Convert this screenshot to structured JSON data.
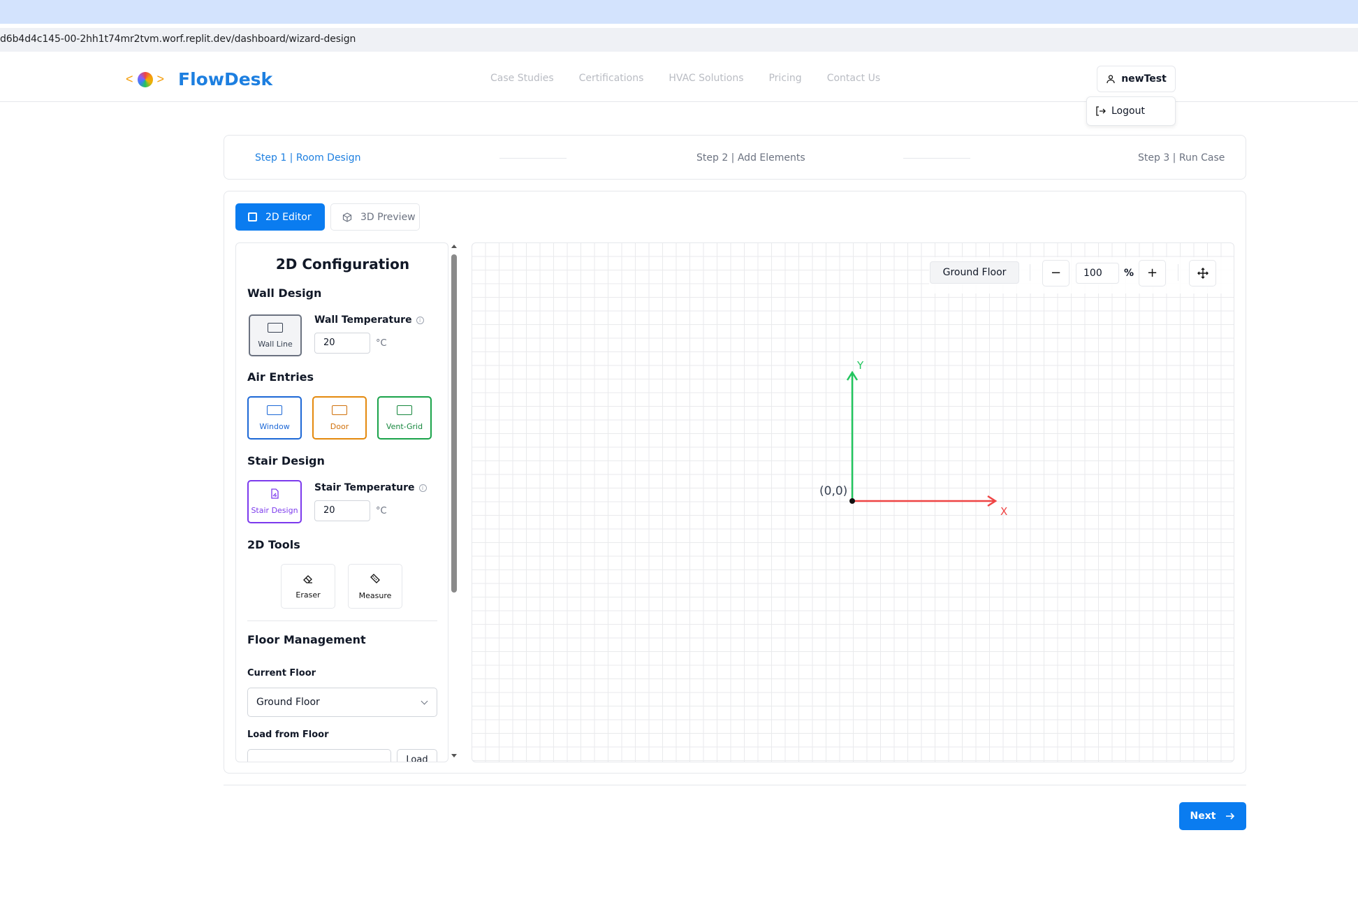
{
  "browser": {
    "url": "d6b4d4c145-00-2hh1t74mr2tvm.worf.replit.dev/dashboard/wizard-design"
  },
  "header": {
    "brand": "FlowDesk",
    "nav": [
      "Case Studies",
      "Certifications",
      "HVAC Solutions",
      "Pricing",
      "Contact Us"
    ],
    "user": "newTest",
    "logout": "Logout"
  },
  "steps": [
    "Step 1 | Room Design",
    "Step 2 | Add Elements",
    "Step 3 | Run Case"
  ],
  "tabs": {
    "editor": "2D Editor",
    "preview": "3D Preview"
  },
  "panel": {
    "title": "2D Configuration",
    "wall_design": "Wall Design",
    "wall_line": "Wall Line",
    "wall_temp_label": "Wall Temperature",
    "wall_temp_value": "20",
    "unit": "°C",
    "air_entries": "Air Entries",
    "window": "Window",
    "door": "Door",
    "vent_grid": "Vent-Grid",
    "stair_design_title": "Stair Design",
    "stair_design_btn": "Stair Design",
    "stair_temp_label": "Stair Temperature",
    "stair_temp_value": "20",
    "tools_title": "2D Tools",
    "eraser": "Eraser",
    "measure": "Measure",
    "floor_mgmt": "Floor Management",
    "current_floor_label": "Current Floor",
    "current_floor_value": "Ground Floor",
    "load_from_label": "Load from Floor",
    "load_btn": "Load"
  },
  "canvas": {
    "floor": "Ground Floor",
    "zoom": "100",
    "zoom_unit": "%",
    "origin_label": "(0,0)",
    "x_label": "X",
    "y_label": "Y"
  },
  "footer": {
    "next": "Next"
  },
  "colors": {
    "primary": "#0a7cf0",
    "x_axis": "#ef4444",
    "y_axis": "#22c55e"
  }
}
